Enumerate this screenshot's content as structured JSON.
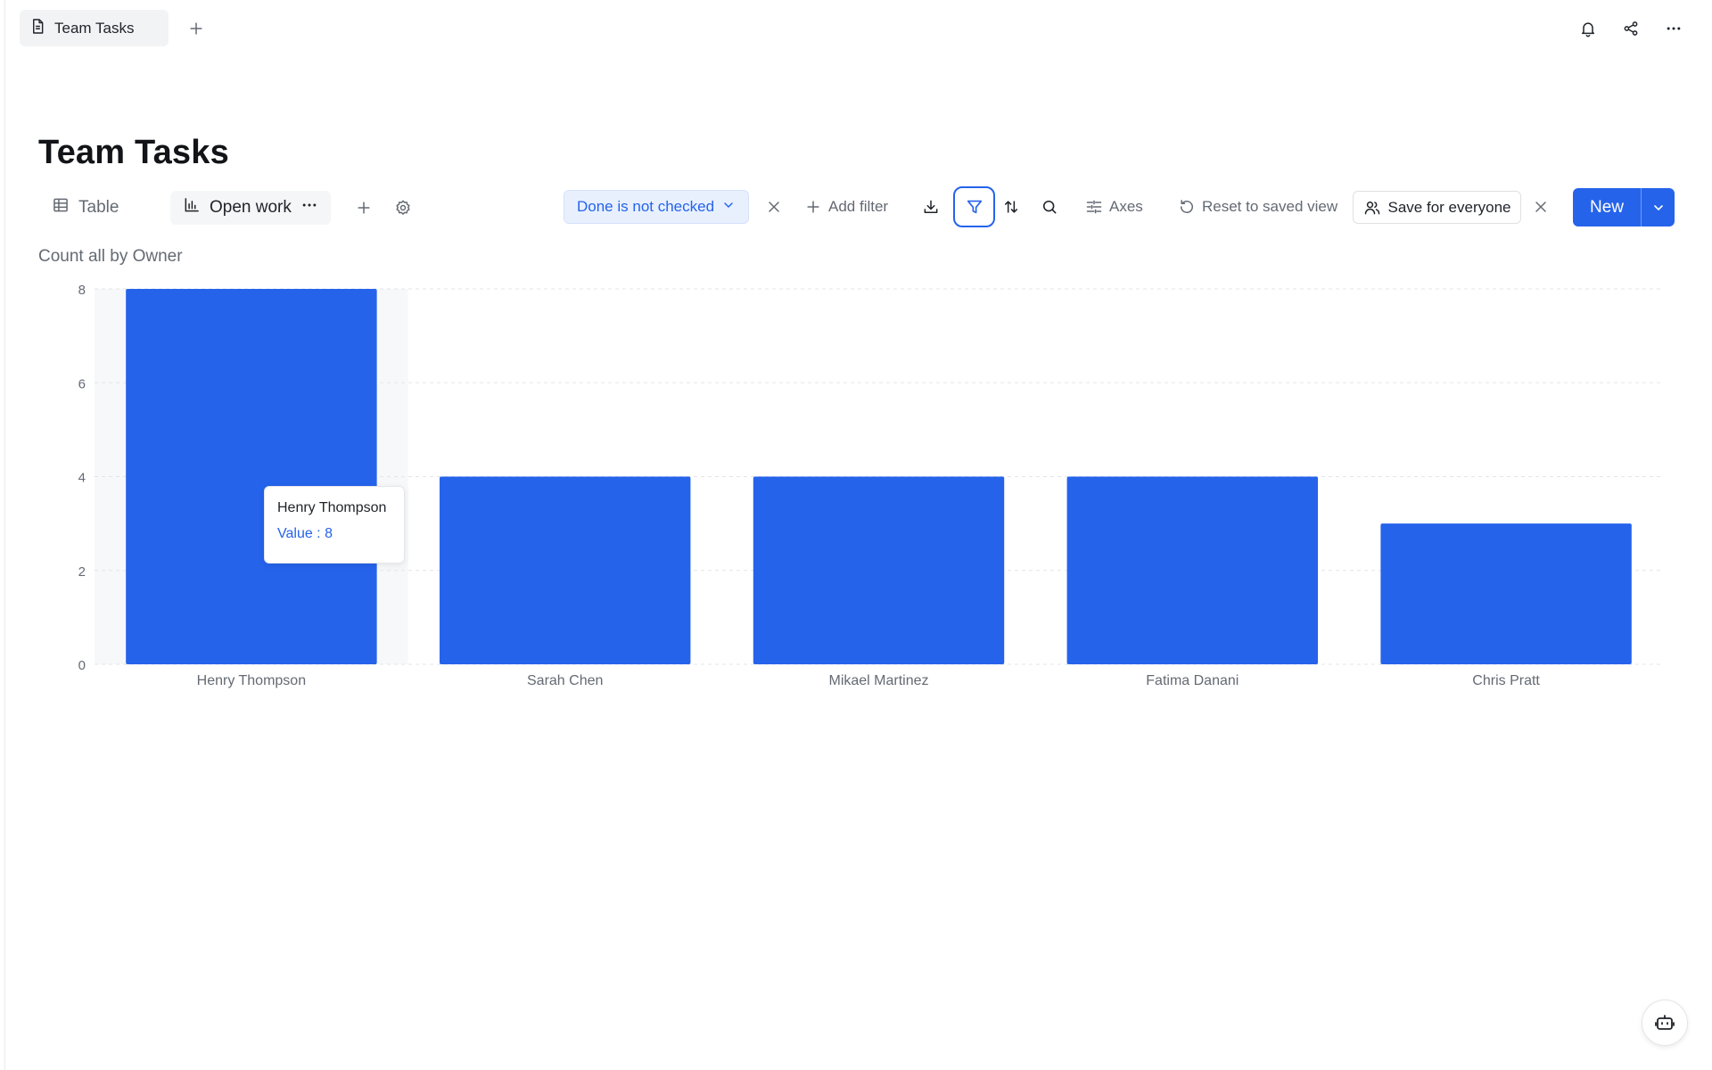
{
  "tab": {
    "label": "Team Tasks",
    "icon": "document-icon"
  },
  "page": {
    "title": "Team Tasks"
  },
  "views": [
    {
      "label": "Table",
      "icon": "table-icon",
      "active": false
    },
    {
      "label": "Open work",
      "icon": "bar-chart-icon",
      "active": true
    }
  ],
  "toolbar": {
    "filter_chip": "Done is not checked",
    "add_filter": "Add filter",
    "axes": "Axes",
    "reset": "Reset to saved view",
    "save_everyone": "Save for everyone",
    "new_label": "New"
  },
  "chart_title": "Count all by Owner",
  "tooltip": {
    "name": "Henry Thompson",
    "value": "Value : 8"
  },
  "colors": {
    "accent": "#2563eb",
    "chip_bg": "#e8f0fe",
    "text_muted": "#646a73"
  },
  "chart_data": {
    "type": "bar",
    "title": "Count all by Owner",
    "categories": [
      "Henry Thompson",
      "Sarah Chen",
      "Mikael Martinez",
      "Fatima Danani",
      "Chris Pratt"
    ],
    "values": [
      8,
      4,
      4,
      4,
      3
    ],
    "ylim": [
      0,
      8
    ],
    "yticks": [
      0,
      2,
      4,
      6,
      8
    ],
    "grid": true,
    "color": "#2563eb"
  }
}
